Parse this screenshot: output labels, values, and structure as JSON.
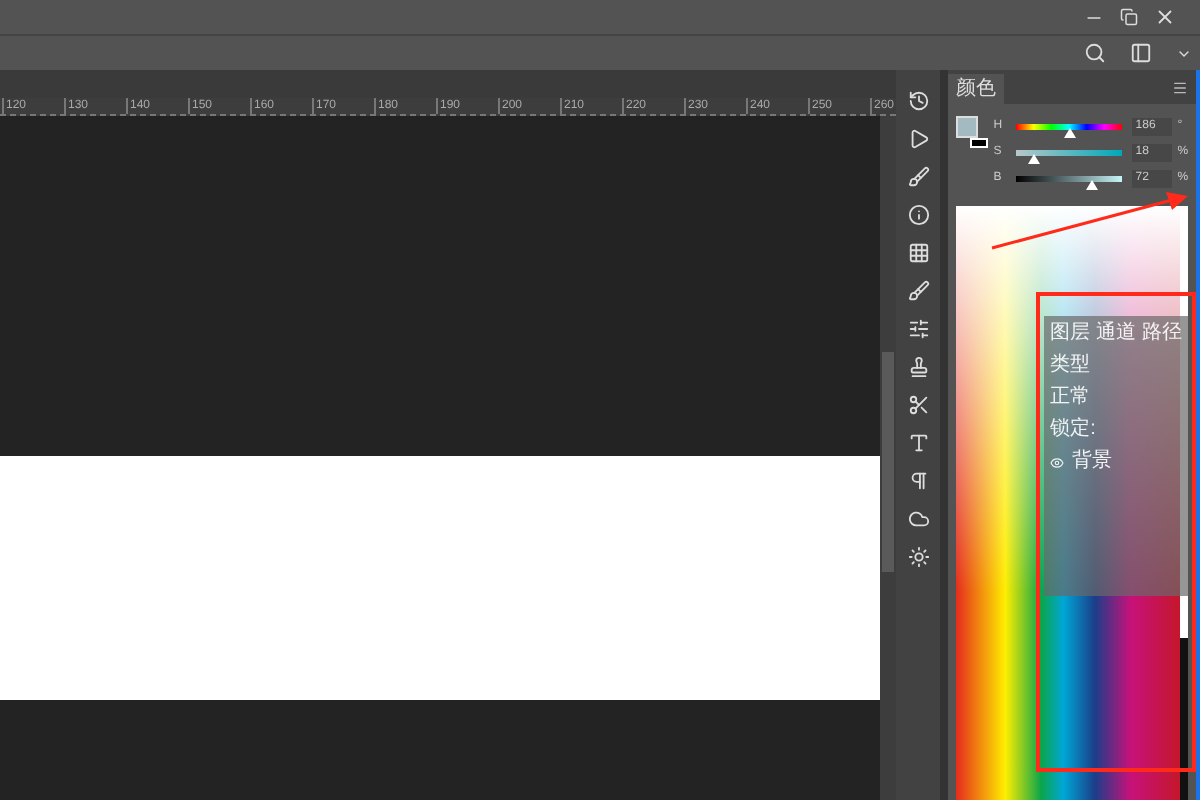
{
  "ruler": {
    "labels": [
      "120",
      "130",
      "140",
      "150",
      "160",
      "170",
      "180",
      "190",
      "200",
      "210",
      "220",
      "230",
      "240",
      "250",
      "260"
    ]
  },
  "color_panel": {
    "tab": "颜色",
    "sliders": [
      {
        "label": "H",
        "value": "186",
        "unit": "°",
        "level": 0.52,
        "kind": "hue"
      },
      {
        "label": "S",
        "value": "18",
        "unit": "%",
        "level": 0.18,
        "kind": "saturation"
      },
      {
        "label": "B",
        "value": "72",
        "unit": "%",
        "level": 0.72,
        "kind": "brightness"
      }
    ]
  },
  "dragged_panel": {
    "tabs": [
      "图层",
      "通道",
      "路径"
    ],
    "search": "类型",
    "blend_mode": "正常",
    "lock": "锁定:",
    "layer": "背景"
  }
}
